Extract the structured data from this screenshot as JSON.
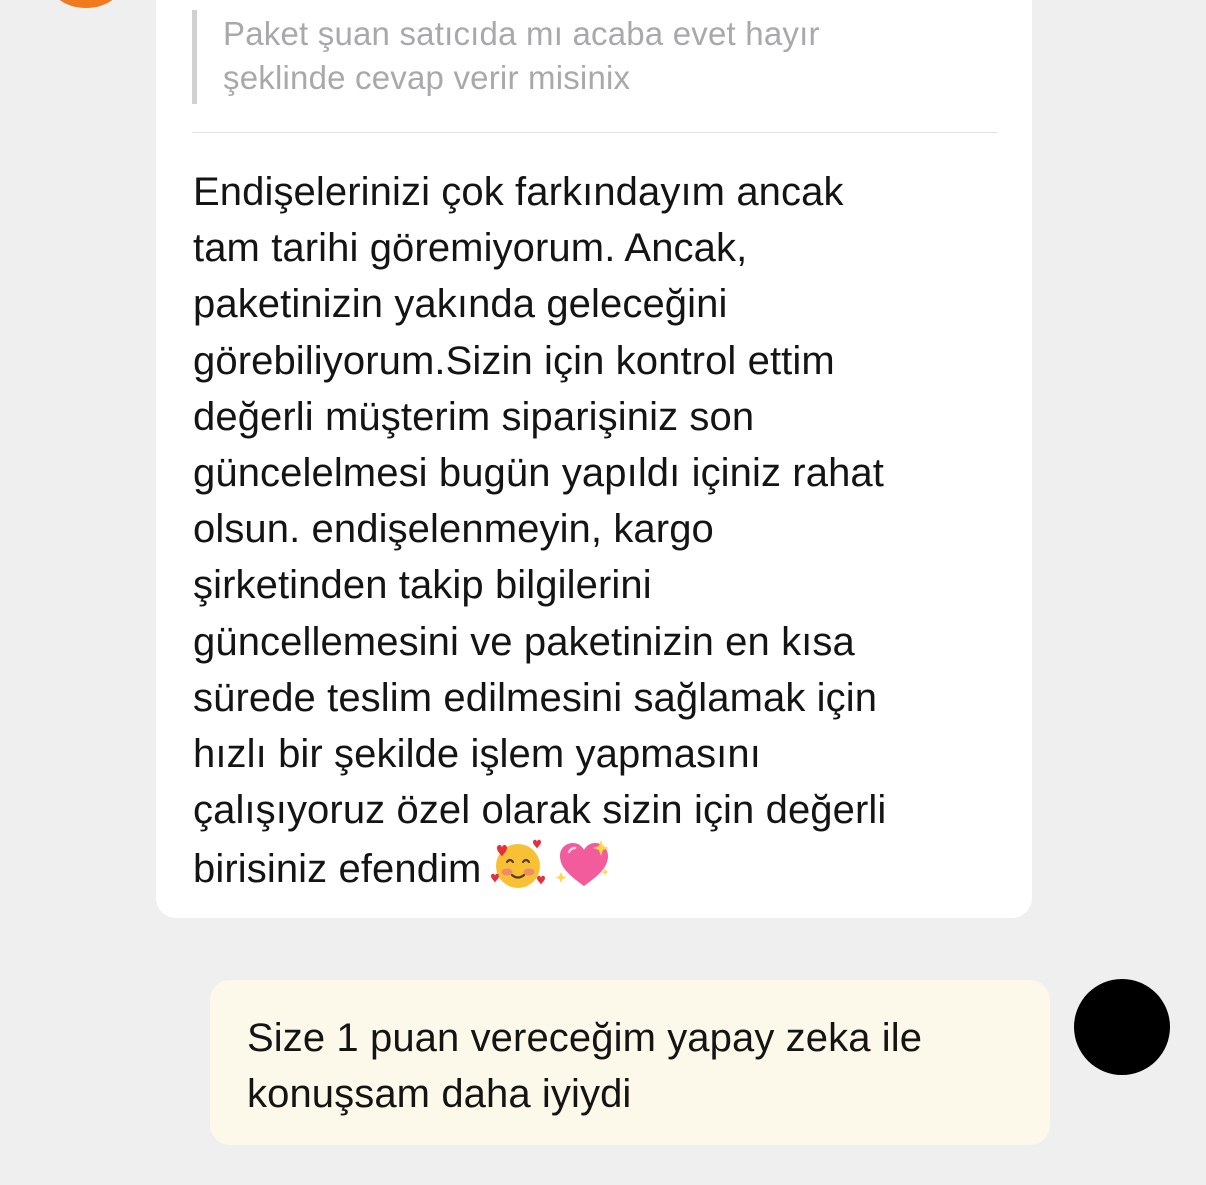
{
  "colors": {
    "background": "#efefef",
    "agent_bubble": "#ffffff",
    "user_bubble": "#fcf8ea",
    "agent_avatar": "#f07a1e",
    "user_avatar": "#000000",
    "quote_bar": "#d1d1d3",
    "quote_text": "#a9a9ab",
    "body_text": "#141414"
  },
  "messages": {
    "agent": {
      "quoted_text": "Paket şuan satıcıda mı acaba evet hayır\nşeklinde cevap verir misinix",
      "text": "Endişelerinizi çok farkındayım ancak\ntam tarihi göremiyorum. Ancak,\npaketinizin yakında geleceğini\ngörebiliyorum.Sizin için kontrol ettim\ndeğerli müşterim siparişiniz son\ngüncelelmesi bugün yapıldı içiniz rahat\nolsun. endişelenmeyin, kargo\nşirketinden takip bilgilerini\ngüncellemesini ve paketinizin en kısa\nsürede teslim edilmesini sağlamak için\nhızlı bir şekilde işlem yapmasını\nçalışıyoruz özel olarak sizin için değerli\nbirisiniz efendim",
      "emojis": [
        "smiling-face-with-hearts-icon",
        "sparkling-heart-icon"
      ]
    },
    "user": {
      "text": "Size 1 puan vereceğim yapay zeka ile\nkonuşsam daha iyiydi"
    }
  }
}
